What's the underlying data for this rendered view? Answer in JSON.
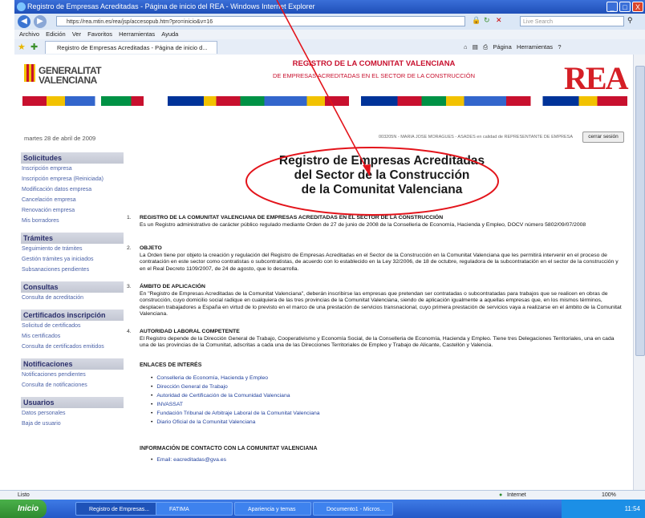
{
  "window": {
    "title": "Registro de Empresas Acreditadas - Página de inicio del REA - Windows Internet Explorer",
    "url": "https://rea.mtin.es/rea/jsp/accesopub.htm?pro=inicio&v=16",
    "search_placeholder": "Live Search",
    "minimize": "_",
    "maximize": "□",
    "close": "X"
  },
  "menu": [
    "Archivo",
    "Edición",
    "Ver",
    "Favoritos",
    "Herramientas",
    "Ayuda"
  ],
  "tab": {
    "label": "Registro de Empresas Acreditadas - Página de inicio d..."
  },
  "toolbar": {
    "pagina": "Página",
    "herramientas": "Herramientas"
  },
  "header": {
    "logo_line1": "GENERALITAT",
    "logo_line2": "VALENCIANA",
    "banner_title": "REGISTRO DE LA COMUNITAT VALENCIANA",
    "banner_subtitle": "DE EMPRESAS ACREDITADAS EN EL SECTOR DE LA CONSTRUCCIÓN",
    "rea_logo": "REA",
    "date": "martes 28 de abril de 2009",
    "user_line": "003205N - MARIA JOSE MORAGUES - ASADES en calidad de REPRESENTANTE DE EMPRESA",
    "logout": "cerrar sesión"
  },
  "sidebar": {
    "solicitudes": {
      "title": "Solicitudes",
      "items": [
        "Inscripción empresa",
        "Inscripción empresa (Reiniciada)",
        "Modificación datos empresa",
        "Cancelación empresa",
        "Renovación empresa",
        "Mis borradores"
      ]
    },
    "tramites": {
      "title": "Trámites",
      "items": [
        "Seguimiento de trámites",
        "Gestión trámites ya iniciados",
        "Subsanaciones pendientes"
      ]
    },
    "consultas": {
      "title": "Consultas",
      "items": [
        "Consulta de acreditación"
      ]
    },
    "certificados": {
      "title": "Certificados inscripción",
      "items": [
        "Solicitud de certificados",
        "Mis certificados",
        "Consulta de certificados emitidos"
      ]
    },
    "notificaciones": {
      "title": "Notificaciones",
      "items": [
        "Notificaciones pendientes",
        "Consulta de notificaciones"
      ]
    },
    "usuarios": {
      "title": "Usuarios",
      "items": [
        "Datos personales",
        "Baja de usuario"
      ]
    }
  },
  "main": {
    "title_line1": "Registro de Empresas Acreditadas",
    "title_line2": "del Sector de la Construcción",
    "title_line3": "de la Comunitat Valenciana",
    "sections": [
      {
        "num": "1.",
        "heading": "REGISTRO DE LA COMUNITAT VALENCIANA DE EMPRESAS ACREDITADAS EN EL SECTOR DE LA CONSTRUCCIÓN",
        "text": "Es un Registro administrativo de carácter público regulado mediante Orden de 27 de junio de 2008 de la Conselleria de Economía, Hacienda y Empleo, DOCV número 5802/09/07/2008"
      },
      {
        "num": "2.",
        "heading": "OBJETO",
        "text": "La Orden tiene por objeto la creación y regulación del Registro de Empresas Acreditadas en el Sector de la Construcción en la Comunitat Valenciana que les permitirá intervenir en el proceso de contratación en este sector como contratistas o subcontratistas, de acuerdo con lo establecido en la Ley 32/2006, de 18 de octubre, reguladora de la subcontratación en el sector de la construcción y en el Real Decreto 1109/2007, de 24 de agosto, que lo desarrolla."
      },
      {
        "num": "3.",
        "heading": "ÁMBITO DE APLICACIÓN",
        "text": "En \"Registro de Empresas Acreditadas de la Comunitat Valenciana\", deberán inscribirse las empresas que pretendan ser contratadas o subcontratadas para trabajos que se realicen en obras de construcción, cuyo domicilio social radique en cualquiera de las tres provincias de la Comunitat Valenciana, siendo de aplicación igualmente a aquellas empresas que, en los mismos términos, desplacen trabajadores a España en virtud de lo previsto en el marco de una prestación de servicios transnacional, cuyo primera prestación de servicios vaya a realizarse en el ámbito de la Comunitat Valenciana."
      },
      {
        "num": "4.",
        "heading": "AUTORIDAD LABORAL COMPETENTE",
        "text": "El Registro depende de la Dirección General de Trabajo, Cooperativismo y Economía Social, de la Conselleria de Economía, Hacienda y Empleo. Tiene tres Delegaciones Territoriales, una en cada una de las provincias de la Comunitat, adscritas a cada una de las Direcciones Territoriales de Empleo y Trabajo de Alicante, Castellón y Valencia."
      }
    ],
    "links_heading": "ENLACES DE INTERÉS",
    "links": [
      "Conselleria de Economía, Hacienda y Empleo",
      "Dirección General de Trabajo",
      "Autoridad de Certificación de la Comunidad Valenciana",
      "INVASSAT",
      "Fundación Tribunal de Arbitraje Laboral de la Comunitat Valenciana",
      "Diario Oficial de la Comunitat Valenciana"
    ],
    "contact_heading": "INFORMACIÓN DE CONTACTO CON LA COMUNITAT VALENCIANA",
    "contact_email": "Email: eacreditadas@gva.es"
  },
  "statusbar": {
    "left": "Listo",
    "zone": "Internet",
    "zoom": "100%"
  },
  "taskbar": {
    "start": "Inicio",
    "tasks": [
      "Registro de Empresas...",
      "FATIMA",
      "Apariencia y temas",
      "Documento1 - Micros..."
    ],
    "clock": "11:54"
  }
}
